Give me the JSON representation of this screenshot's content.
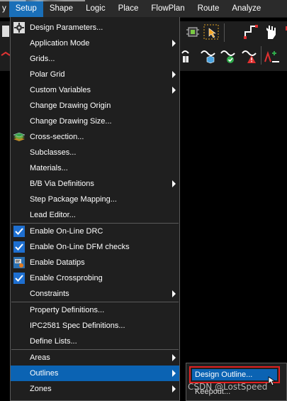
{
  "menubar": {
    "items": [
      {
        "label": "y"
      },
      {
        "label": "Setup",
        "active": true
      },
      {
        "label": "Shape"
      },
      {
        "label": "Logic"
      },
      {
        "label": "Place"
      },
      {
        "label": "FlowPlan"
      },
      {
        "label": "Route"
      },
      {
        "label": "Analyze"
      }
    ],
    "active_color": "#1a6fb8"
  },
  "setup_menu": {
    "items": [
      {
        "label": "Design Parameters...",
        "icon": "gear-icon"
      },
      {
        "label": "Application Mode",
        "submenu": true
      },
      {
        "label": "Grids..."
      },
      {
        "label": "Polar Grid",
        "submenu": true
      },
      {
        "label": "Custom Variables",
        "submenu": true
      },
      {
        "label": "Change Drawing Origin"
      },
      {
        "label": "Change Drawing Size..."
      },
      {
        "label": "Cross-section...",
        "icon": "layer-stack-icon"
      },
      {
        "label": "Subclasses..."
      },
      {
        "label": "Materials..."
      },
      {
        "label": "B/B Via Definitions",
        "submenu": true
      },
      {
        "label": "Step Package Mapping..."
      },
      {
        "label": "Lead Editor..."
      },
      {
        "label": "Enable On-Line DRC",
        "checked": true
      },
      {
        "label": "Enable On-Line DFM checks",
        "checked": true
      },
      {
        "label": "Enable Datatips",
        "icon": "datatip-icon"
      },
      {
        "label": "Enable Crossprobing",
        "checked": true
      },
      {
        "label": "Constraints",
        "submenu": true
      },
      {
        "label": "Property Definitions..."
      },
      {
        "label": "IPC2581 Spec Definitions..."
      },
      {
        "label": "Define Lists..."
      },
      {
        "label": "Areas",
        "submenu": true
      },
      {
        "label": "Outlines",
        "submenu": true,
        "highlighted": true
      },
      {
        "label": "Zones",
        "submenu": true
      }
    ],
    "highlight_color": "#0b63b3"
  },
  "outlines_submenu": {
    "items": [
      {
        "label": "Design Outline...",
        "highlighted": true
      },
      {
        "label": "Keepout..."
      }
    ],
    "callout_color": "#e02020"
  },
  "watermark": "CSDN @LostSpeed"
}
